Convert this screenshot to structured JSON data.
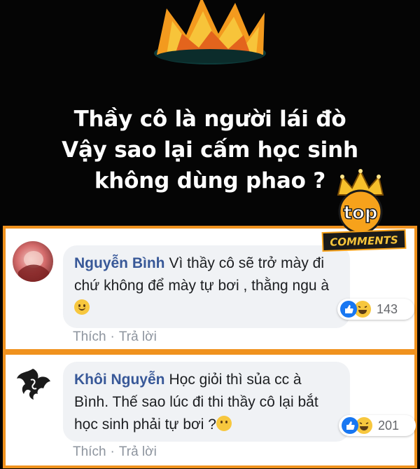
{
  "headline": {
    "line1": "Thầy cô là người lái đò",
    "line2": "Vậy sao lại cấm học sinh",
    "line3": "không dùng phao ?"
  },
  "badge": {
    "top_text": "top",
    "bottom_text": "COMMENTS"
  },
  "colors": {
    "frame": "#f0921e",
    "author": "#385898",
    "like": "#1877f2",
    "haha": "#f7c73e"
  },
  "comments": [
    {
      "author": "Nguyễn Bình",
      "text": "Vì thầy cô sẽ trở mày đi chứ không để mày tự bơi , thằng ngu à",
      "emoji": "slightly-smiling-face",
      "reaction_count": "143",
      "actions": {
        "like": "Thích",
        "reply": "Trả lời",
        "separator": "·"
      }
    },
    {
      "author": "Khôi Nguyễn",
      "text": "Học giỏi thì sủa cc à Bình. Thế sao lúc đi thi thầy cô lại bắt học sinh phải tự bơi ?",
      "emoji": "neutral-face",
      "reaction_count": "201",
      "actions": {
        "like": "Thích",
        "reply": "Trả lời",
        "separator": "·"
      }
    }
  ]
}
